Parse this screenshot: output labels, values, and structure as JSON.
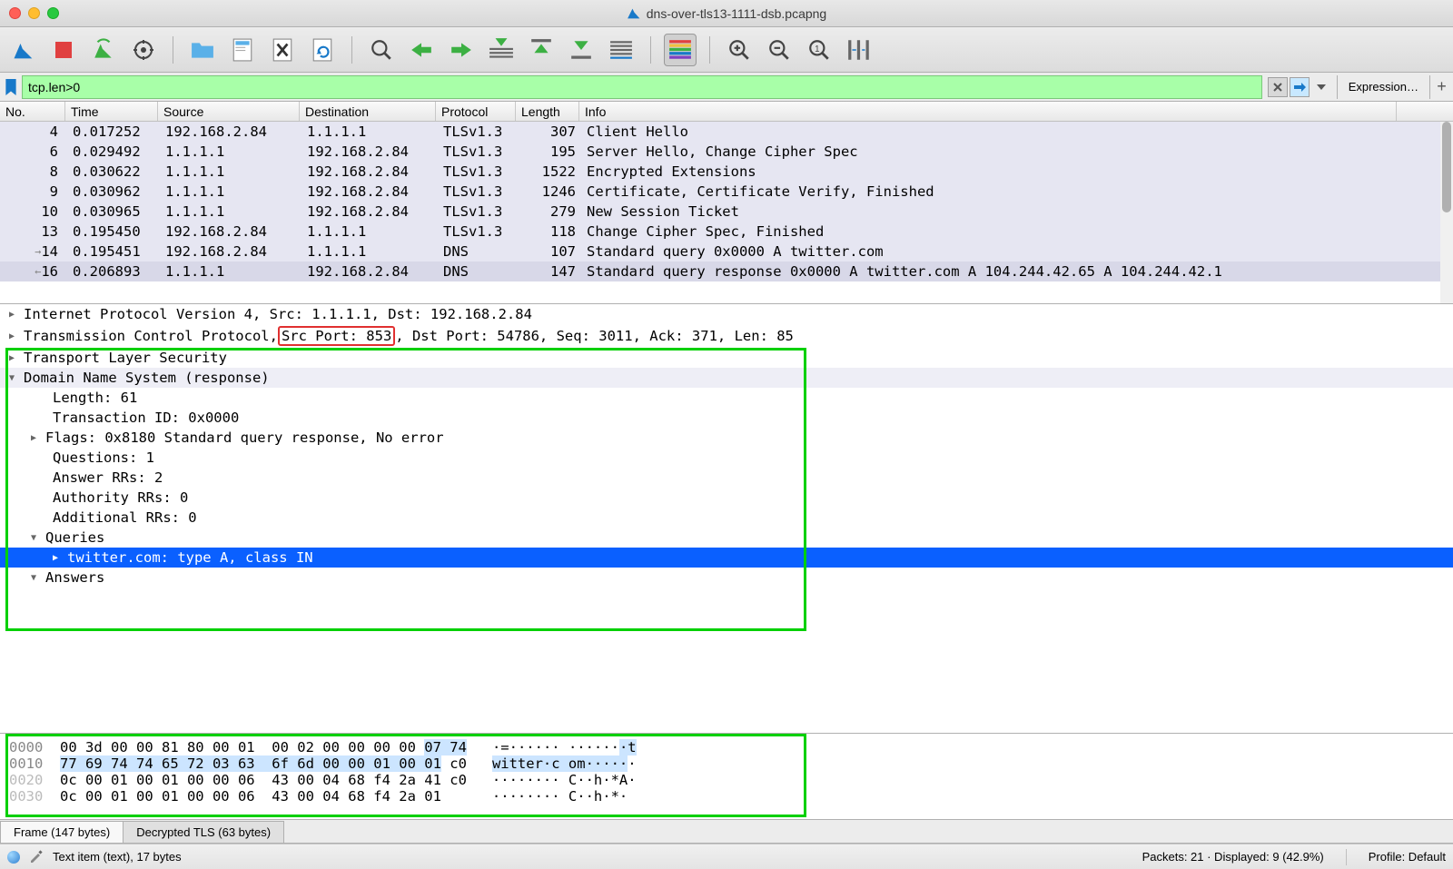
{
  "window": {
    "title": "dns-over-tls13-1111-dsb.pcapng"
  },
  "filter": {
    "value": "tcp.len>0",
    "expression_label": "Expression…"
  },
  "columns": {
    "no": "No.",
    "time": "Time",
    "source": "Source",
    "destination": "Destination",
    "protocol": "Protocol",
    "length": "Length",
    "info": "Info"
  },
  "col_widths": {
    "no": 72,
    "time": 102,
    "source": 156,
    "destination": 150,
    "protocol": 88,
    "length": 70
  },
  "packets": [
    {
      "no": "4",
      "time": "0.017252",
      "src": "192.168.2.84",
      "dst": "1.1.1.1",
      "proto": "TLSv1.3",
      "len": "307",
      "info": "Client Hello",
      "bg": "#e6e6f2"
    },
    {
      "no": "6",
      "time": "0.029492",
      "src": "1.1.1.1",
      "dst": "192.168.2.84",
      "proto": "TLSv1.3",
      "len": "195",
      "info": "Server Hello, Change Cipher Spec",
      "bg": "#e6e6f2"
    },
    {
      "no": "8",
      "time": "0.030622",
      "src": "1.1.1.1",
      "dst": "192.168.2.84",
      "proto": "TLSv1.3",
      "len": "1522",
      "info": "Encrypted Extensions",
      "bg": "#e6e6f2"
    },
    {
      "no": "9",
      "time": "0.030962",
      "src": "1.1.1.1",
      "dst": "192.168.2.84",
      "proto": "TLSv1.3",
      "len": "1246",
      "info": "Certificate, Certificate Verify, Finished",
      "bg": "#e6e6f2"
    },
    {
      "no": "10",
      "time": "0.030965",
      "src": "1.1.1.1",
      "dst": "192.168.2.84",
      "proto": "TLSv1.3",
      "len": "279",
      "info": "New Session Ticket",
      "bg": "#e6e6f2"
    },
    {
      "no": "13",
      "time": "0.195450",
      "src": "192.168.2.84",
      "dst": "1.1.1.1",
      "proto": "TLSv1.3",
      "len": "118",
      "info": "Change Cipher Spec, Finished",
      "bg": "#e6e6f2"
    },
    {
      "no": "14",
      "time": "0.195451",
      "src": "192.168.2.84",
      "dst": "1.1.1.1",
      "proto": "DNS",
      "len": "107",
      "info": "Standard query 0x0000 A twitter.com",
      "bg": "#e6e6f2",
      "arrow": "→"
    },
    {
      "no": "16",
      "time": "0.206893",
      "src": "1.1.1.1",
      "dst": "192.168.2.84",
      "proto": "DNS",
      "len": "147",
      "info": "Standard query response 0x0000 A twitter.com A 104.244.42.65 A 104.244.42.1",
      "bg": "#d8d8e8",
      "arrow": "←"
    }
  ],
  "details": {
    "ipv4": "Internet Protocol Version 4, Src: 1.1.1.1, Dst: 192.168.2.84",
    "tcp_pre": "Transmission Control Protocol, ",
    "tcp_src": "Src Port: 853",
    "tcp_post": ", Dst Port: 54786, Seq: 3011, Ack: 371, Len: 85",
    "tls": "Transport Layer Security",
    "dns": "Domain Name System (response)",
    "dns_len": "Length: 61",
    "dns_txid": "Transaction ID: 0x0000",
    "dns_flags": "Flags: 0x8180 Standard query response, No error",
    "dns_q": "Questions: 1",
    "dns_arr": "Answer RRs: 2",
    "dns_auth": "Authority RRs: 0",
    "dns_add": "Additional RRs: 0",
    "queries": "Queries",
    "query_item": "twitter.com: type A, class IN",
    "answers": "Answers"
  },
  "hex": {
    "l0": {
      "off": "0000",
      "bytes": "00 3d 00 00 81 80 00 01  00 02 00 00 00 00 ",
      "hl": "07 74",
      "post": "   ",
      "ascii": "·=······ ······",
      "ascii_hl": "·t"
    },
    "l1": {
      "off": "0010",
      "hl": "77 69 74 74 65 72 03 63  6f 6d 00 00 01 00 01",
      "post": " c0   ",
      "ascii_hl": "witter·c om·····",
      "ascii_post": "·"
    },
    "l2": {
      "off": "0020",
      "bytes": "0c 00 01 00 01 00 00 06  43 00 04 68 f4 2a 41 c0   ",
      "ascii": "········ C··h·*A·"
    },
    "l3": {
      "off": "0030",
      "bytes": "0c 00 01 00 01 00 00 06  43 00 04 68 f4 2a 01      ",
      "ascii": "········ C··h·*·"
    }
  },
  "tabs": {
    "frame": "Frame (147 bytes)",
    "decrypted": "Decrypted TLS (63 bytes)"
  },
  "status": {
    "left": "Text item (text), 17 bytes",
    "packets": "Packets: 21 · Displayed: 9 (42.9%)",
    "profile": "Profile: Default"
  }
}
